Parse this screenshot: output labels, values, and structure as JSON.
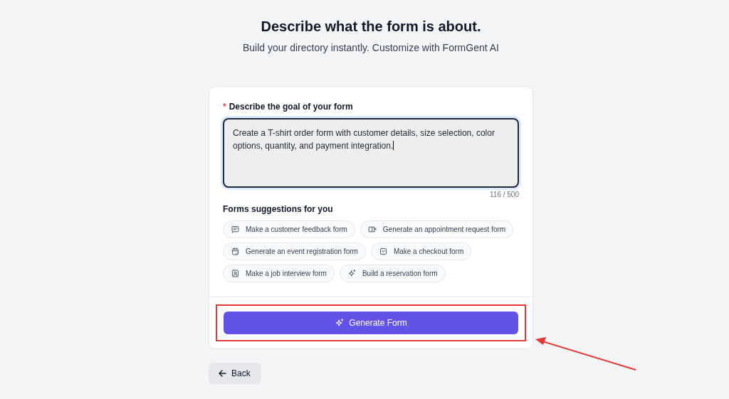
{
  "header": {
    "title": "Describe what the form is about.",
    "subtitle": "Build your directory instantly. Customize with FormGent AI"
  },
  "goal": {
    "label": "Describe the goal of your form",
    "required_mark": "*",
    "value": "Create a T-shirt order form with customer details, size selection, color options, quantity, and payment integration.",
    "focused": true,
    "counter": "116 / 500"
  },
  "suggestions": {
    "heading": "Forms suggestions for you",
    "items": [
      {
        "kind": "chat",
        "label": "Make a customer feedback form"
      },
      {
        "kind": "book",
        "label": "Generate an appointment request form"
      },
      {
        "kind": "calendar",
        "label": "Generate an event registration form"
      },
      {
        "kind": "bag",
        "label": "Make a checkout form"
      },
      {
        "kind": "badge",
        "label": "Make a job interview form"
      },
      {
        "kind": "sparkle",
        "label": "Build a reservation form"
      }
    ]
  },
  "generate_button": {
    "label": "Generate Form",
    "highlighted": true
  },
  "back_button": {
    "label": "Back"
  }
}
